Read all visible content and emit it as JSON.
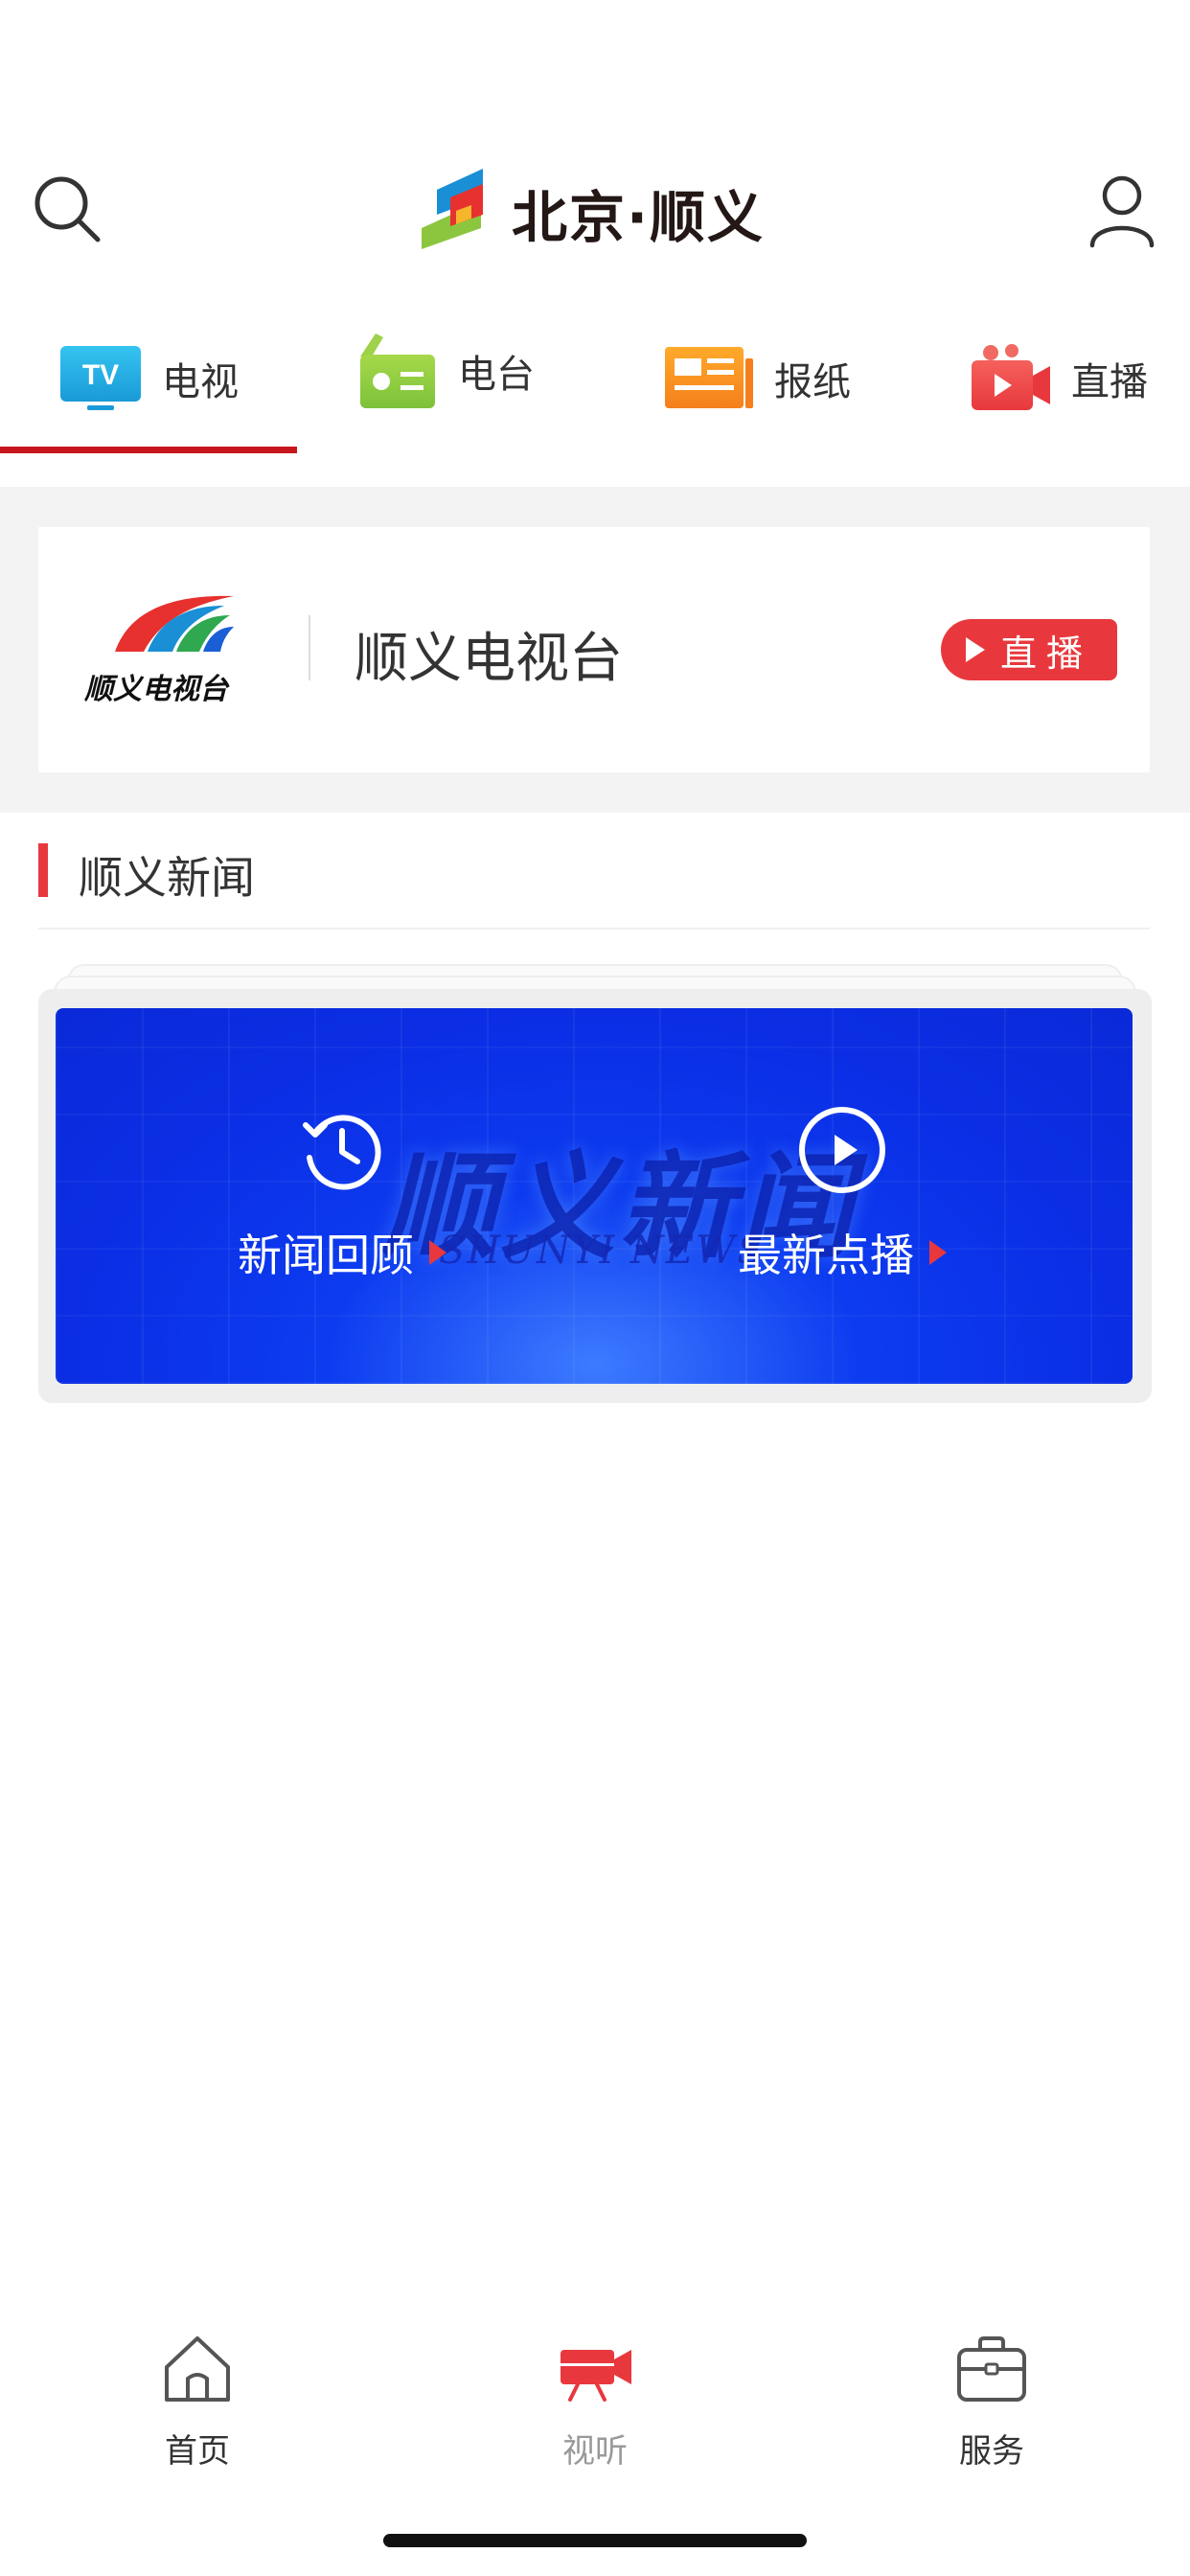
{
  "header": {
    "logo_text": "北京·顺义"
  },
  "tabs": [
    {
      "label": "电视",
      "icon": "tv-icon",
      "active": true
    },
    {
      "label": "电台",
      "icon": "radio-icon",
      "active": false
    },
    {
      "label": "报纸",
      "icon": "newspaper-icon",
      "active": false
    },
    {
      "label": "直播",
      "icon": "live-camera-icon",
      "active": false
    }
  ],
  "station": {
    "logo_text": "顺义电视台",
    "name": "顺义电视台",
    "live_label": "直播"
  },
  "section": {
    "title": "顺义新闻"
  },
  "news_banner": {
    "watermark_cn": "顺义新闻",
    "watermark_en": "SHUNYI NEWS",
    "review_label": "新闻回顾",
    "latest_label": "最新点播"
  },
  "bottom_nav": [
    {
      "label": "首页",
      "icon": "home-icon",
      "active": false
    },
    {
      "label": "视听",
      "icon": "video-camera-icon",
      "active": true
    },
    {
      "label": "服务",
      "icon": "briefcase-icon",
      "active": false
    }
  ],
  "colors": {
    "accent_red": "#e8383d",
    "tab_indicator": "#c8161d",
    "banner_blue": "#0d3cf0"
  }
}
